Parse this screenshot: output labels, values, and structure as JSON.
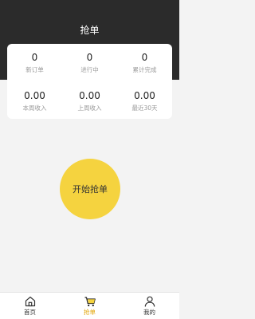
{
  "header": {
    "title": "抢单"
  },
  "stats": {
    "row1": [
      {
        "value": "0",
        "label": "新订单"
      },
      {
        "value": "0",
        "label": "进行中"
      },
      {
        "value": "0",
        "label": "累计完成"
      }
    ],
    "row2": [
      {
        "value": "0.00",
        "label": "本周收入"
      },
      {
        "value": "0.00",
        "label": "上周收入"
      },
      {
        "value": "0.00",
        "label": "最近30天"
      }
    ]
  },
  "start_button": {
    "label": "开始抢单"
  },
  "tabbar": {
    "items": [
      {
        "label": "首页",
        "icon": "home-icon"
      },
      {
        "label": "抢单",
        "icon": "cart-icon"
      },
      {
        "label": "我的",
        "icon": "user-icon"
      }
    ],
    "active": "抢单",
    "active_color": "#e2a300"
  },
  "colors": {
    "header_bg": "#2b2b2b",
    "accent": "#f5d33f"
  }
}
